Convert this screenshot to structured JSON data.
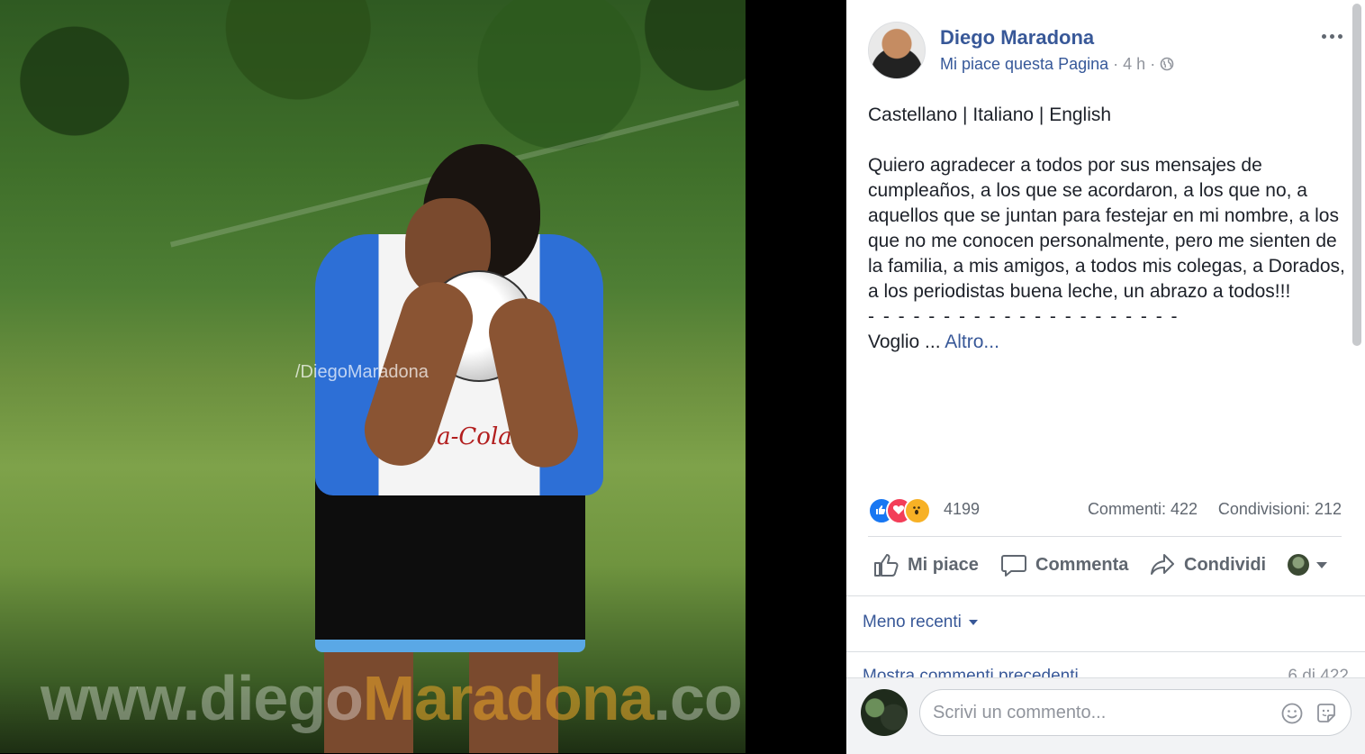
{
  "photo": {
    "fb_watermark": "/DiegoMaradona",
    "site_watermark_part1": "www.diego",
    "site_watermark_part2": "Maradona",
    "site_watermark_part3": ".com",
    "shirt_text": "Coca-Cola"
  },
  "post": {
    "author": "Diego Maradona",
    "like_page": "Mi piace questa Pagina",
    "time": "4 h",
    "separator": "·",
    "body_languages": "Castellano | Italiano | English",
    "body_text": "Quiero agradecer a todos por sus mensajes de cumpleaños, a los que se acordaron, a los que no, a aquellos que se juntan para festejar en mi nombre, a los que no me conocen personalmente, pero me sienten de la familia, a mis amigos, a todos mis colegas, a Dorados, a los periodistas buena leche, un abrazo a todos!!!",
    "dashes": "- - - - - - - - - - - - - - - - - - - - -",
    "truncated_text": "Voglio ...",
    "see_more": "Altro..."
  },
  "stats": {
    "reactions_count": "4199",
    "comments": "Commenti: 422",
    "shares": "Condivisioni: 212",
    "reaction_types": [
      "like",
      "love",
      "wow"
    ]
  },
  "actions": {
    "like": "Mi piace",
    "comment": "Commenta",
    "share": "Condividi"
  },
  "comments": {
    "sort_label": "Meno recenti",
    "previous_label": "Mostra commenti precedenti",
    "previous_count": "6 di 422",
    "input_placeholder": "Scrivi un commento..."
  },
  "colors": {
    "link": "#385898",
    "muted": "#90949c",
    "like_reaction": "#1877f2",
    "love_reaction": "#f33e58",
    "wow_reaction": "#f7b125"
  },
  "icons": [
    "globe-icon",
    "more-options-icon",
    "like-reaction-icon",
    "love-reaction-icon",
    "wow-reaction-icon",
    "thumbs-up-icon",
    "comment-bubble-icon",
    "share-arrow-icon",
    "caret-down-icon",
    "emoji-icon",
    "sticker-icon"
  ]
}
